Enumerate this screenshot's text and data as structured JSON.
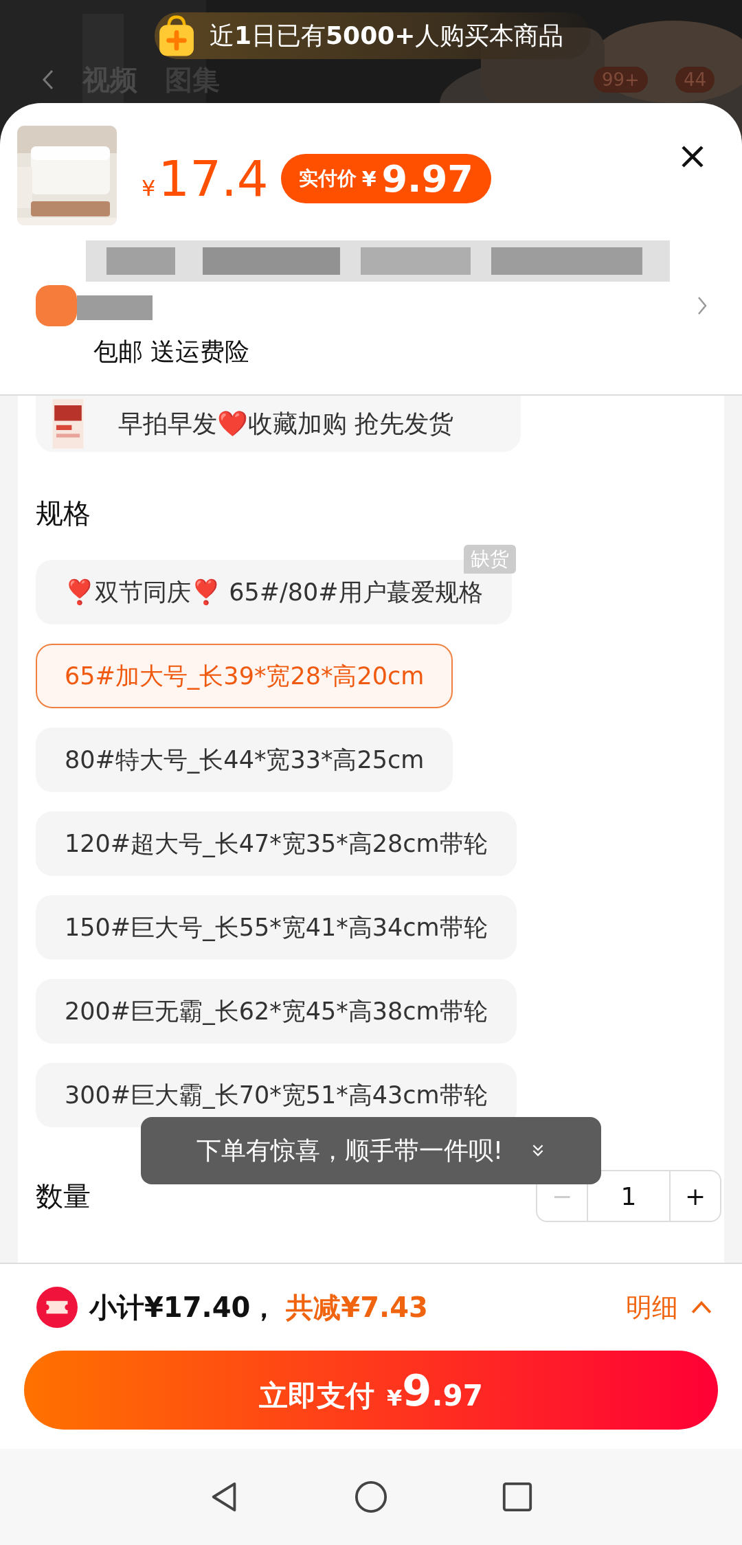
{
  "banner": {
    "text": "近**1**日已有**5000+**人购买本商品"
  },
  "background_tabs": [
    {
      "label": "视频",
      "selected": true
    },
    {
      "label": "图集",
      "selected": false
    }
  ],
  "background_badges": [
    "99+",
    "44"
  ],
  "product": {
    "price_symbol": "¥",
    "price": "17.4",
    "pay_label": "实付价",
    "pay_symbol": "¥",
    "pay_price": "9.97"
  },
  "shipping": {
    "text": "包邮 送运费险"
  },
  "promo_option": {
    "label": "早拍早发❤️收藏加购 抢先发货"
  },
  "spec_section": {
    "title": "规格",
    "options": [
      {
        "label": "❣️双节同庆❣️ 65#/80#用户蕞爱规格",
        "selected": false,
        "tag": "缺货"
      },
      {
        "label": "65#加大号_长39*宽28*高20cm",
        "selected": true
      },
      {
        "label": "80#特大号_长44*宽33*高25cm",
        "selected": false
      },
      {
        "label": "120#超大号_长47*宽35*高28cm带轮",
        "selected": false
      },
      {
        "label": "150#巨大号_长55*宽41*高34cm带轮",
        "selected": false
      },
      {
        "label": "200#巨无霸_长62*宽45*高38cm带轮",
        "selected": false
      },
      {
        "label": "300#巨大霸_长70*宽51*高43cm带轮",
        "selected": false
      }
    ]
  },
  "toast": {
    "text": "下单有惊喜，顺手带一件呗!"
  },
  "quantity": {
    "label": "数量",
    "minus": "−",
    "value": "1",
    "plus": "+",
    "minus_disabled": true
  },
  "summary": {
    "subtotal": "小计¥17.40，",
    "discount": "共减¥7.43",
    "details": "明细"
  },
  "pay_button": {
    "label": "立即支付",
    "symbol": "¥",
    "integer": "9",
    "decimal": ".97"
  }
}
